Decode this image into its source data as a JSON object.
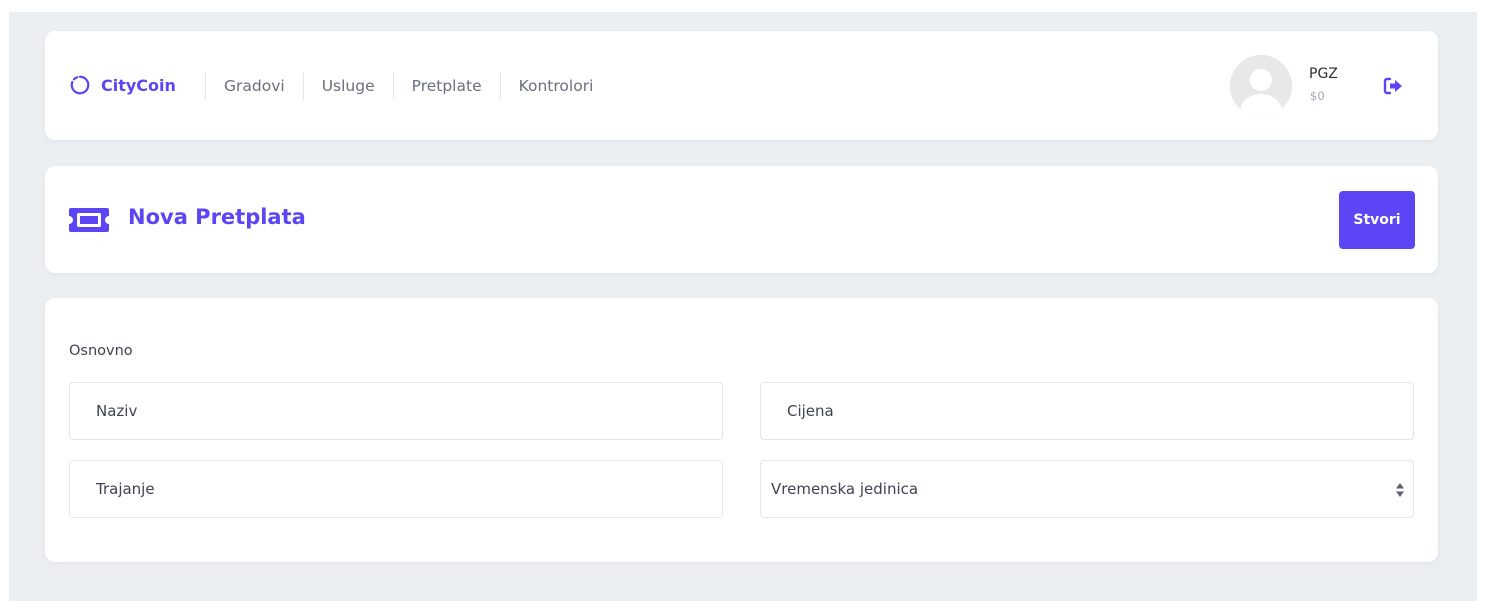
{
  "nav": {
    "brand": "CityCoin",
    "links": [
      "Gradovi",
      "Usluge",
      "Pretplate",
      "Kontrolori"
    ],
    "user": {
      "name": "PGZ",
      "balance": "$0"
    },
    "icons": {
      "brand": "circle-loader-icon",
      "logout": "sign-out-icon",
      "avatar": "user-avatar-placeholder"
    }
  },
  "header": {
    "title": "Nova Pretplata",
    "create_label": "Stvori",
    "icon": "ticket-icon"
  },
  "form": {
    "section_label": "Osnovno",
    "name_placeholder": "Naziv",
    "price_placeholder": "Cijena",
    "duration_placeholder": "Trajanje",
    "unit_selected": "Vremenska jedinica"
  },
  "colors": {
    "accent": "#5b45f5",
    "background": "#ebeff2",
    "card": "#ffffff"
  }
}
